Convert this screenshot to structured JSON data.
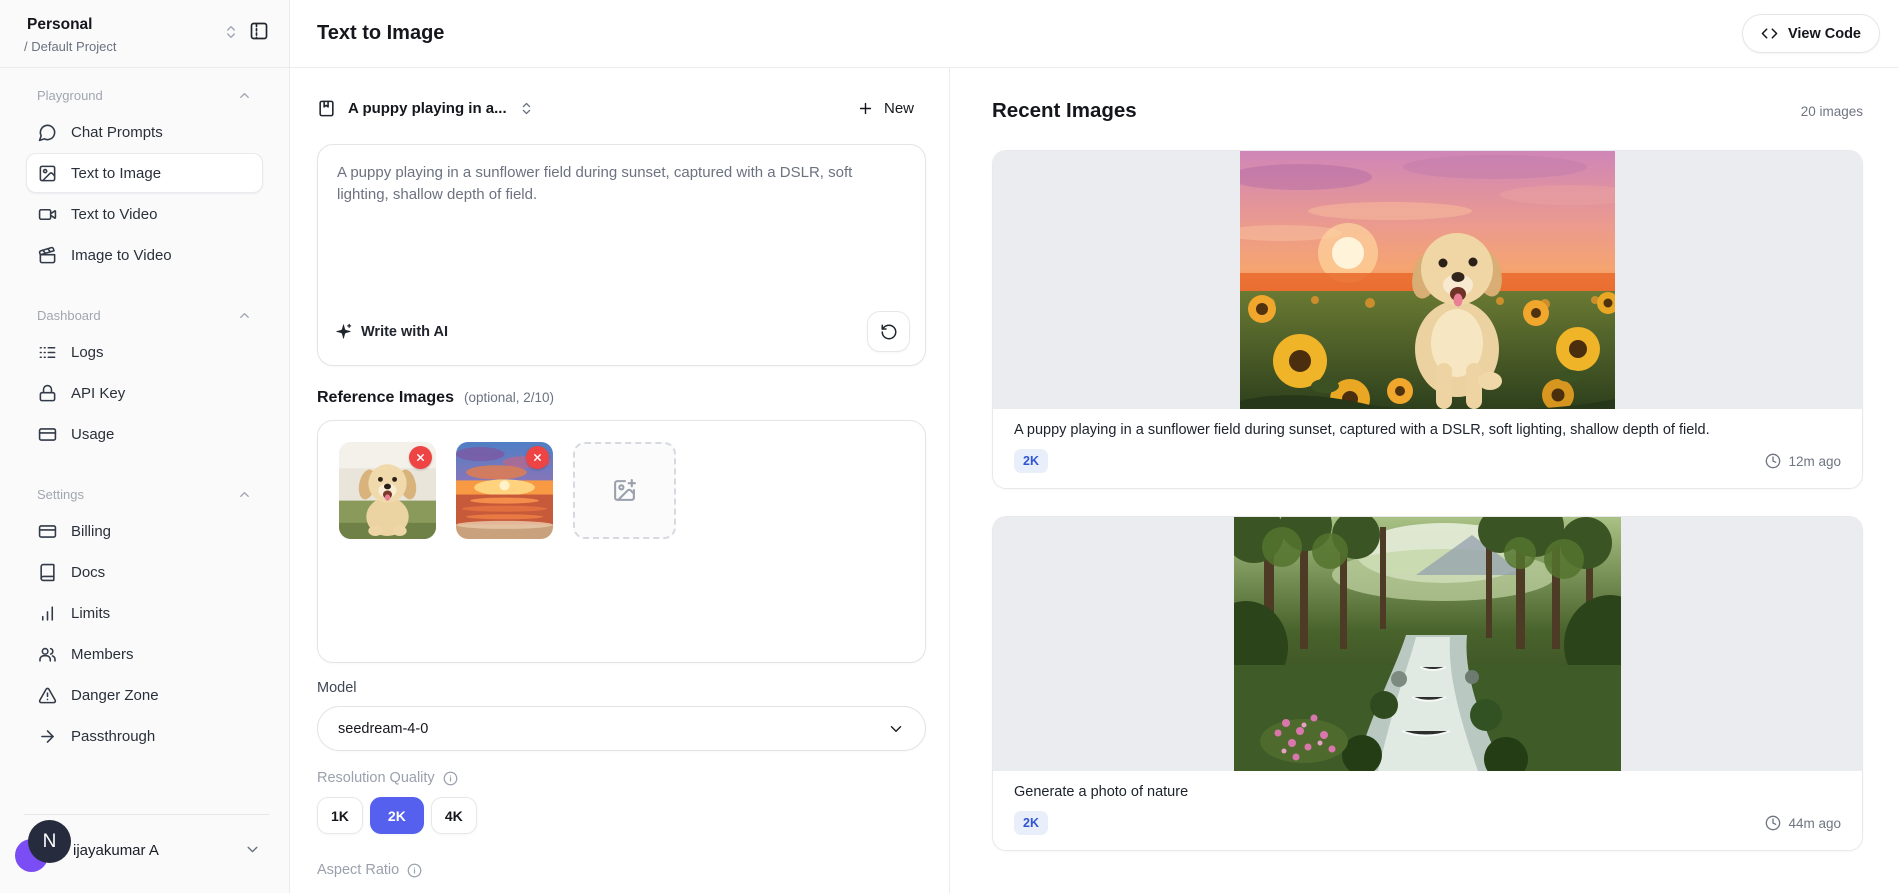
{
  "colors": {
    "accent": "#5560ee",
    "danger": "#ef4444",
    "badge_bg": "#e9eefb",
    "badge_text": "#3056d3",
    "avatar_purple": "#7a4df5",
    "avatar_dark": "#262c3e"
  },
  "workspace": {
    "name": "Personal",
    "project": "/ Default Project"
  },
  "sidebar": {
    "sections": [
      {
        "label": "Playground",
        "items": [
          {
            "label": "Chat Prompts"
          },
          {
            "label": "Text to Image"
          },
          {
            "label": "Text to Video"
          },
          {
            "label": "Image to Video"
          }
        ]
      },
      {
        "label": "Dashboard",
        "items": [
          {
            "label": "Logs"
          },
          {
            "label": "API Key"
          },
          {
            "label": "Usage"
          }
        ]
      },
      {
        "label": "Settings",
        "items": [
          {
            "label": "Billing"
          },
          {
            "label": "Docs"
          },
          {
            "label": "Limits"
          },
          {
            "label": "Members"
          },
          {
            "label": "Danger Zone"
          },
          {
            "label": "Passthrough"
          }
        ]
      }
    ],
    "user": {
      "initial": "N",
      "name": "ijayakumar A"
    }
  },
  "header": {
    "title": "Text to Image",
    "view_code": "View Code"
  },
  "composer": {
    "preset": "A puppy playing in a...",
    "new_label": "New",
    "prompt": "A puppy playing in a sunflower field during sunset, captured with a DSLR, soft lighting, shallow depth of field.",
    "write_ai": "Write with AI",
    "reference": {
      "title": "Reference Images",
      "hint": "(optional, 2/10)"
    },
    "model": {
      "label": "Model",
      "value": "seedream-4-0"
    },
    "resolution": {
      "label": "Resolution Quality",
      "options": [
        "1K",
        "2K",
        "4K"
      ],
      "selected": "2K"
    },
    "aspect": {
      "label": "Aspect Ratio"
    }
  },
  "recent": {
    "title": "Recent Images",
    "count": "20 images",
    "cards": [
      {
        "caption": "A puppy playing in a sunflower field during sunset, captured with a DSLR, soft lighting, shallow depth of field.",
        "badge": "2K",
        "time": "12m ago"
      },
      {
        "caption": "Generate a photo of nature",
        "badge": "2K",
        "time": "44m ago"
      }
    ]
  }
}
